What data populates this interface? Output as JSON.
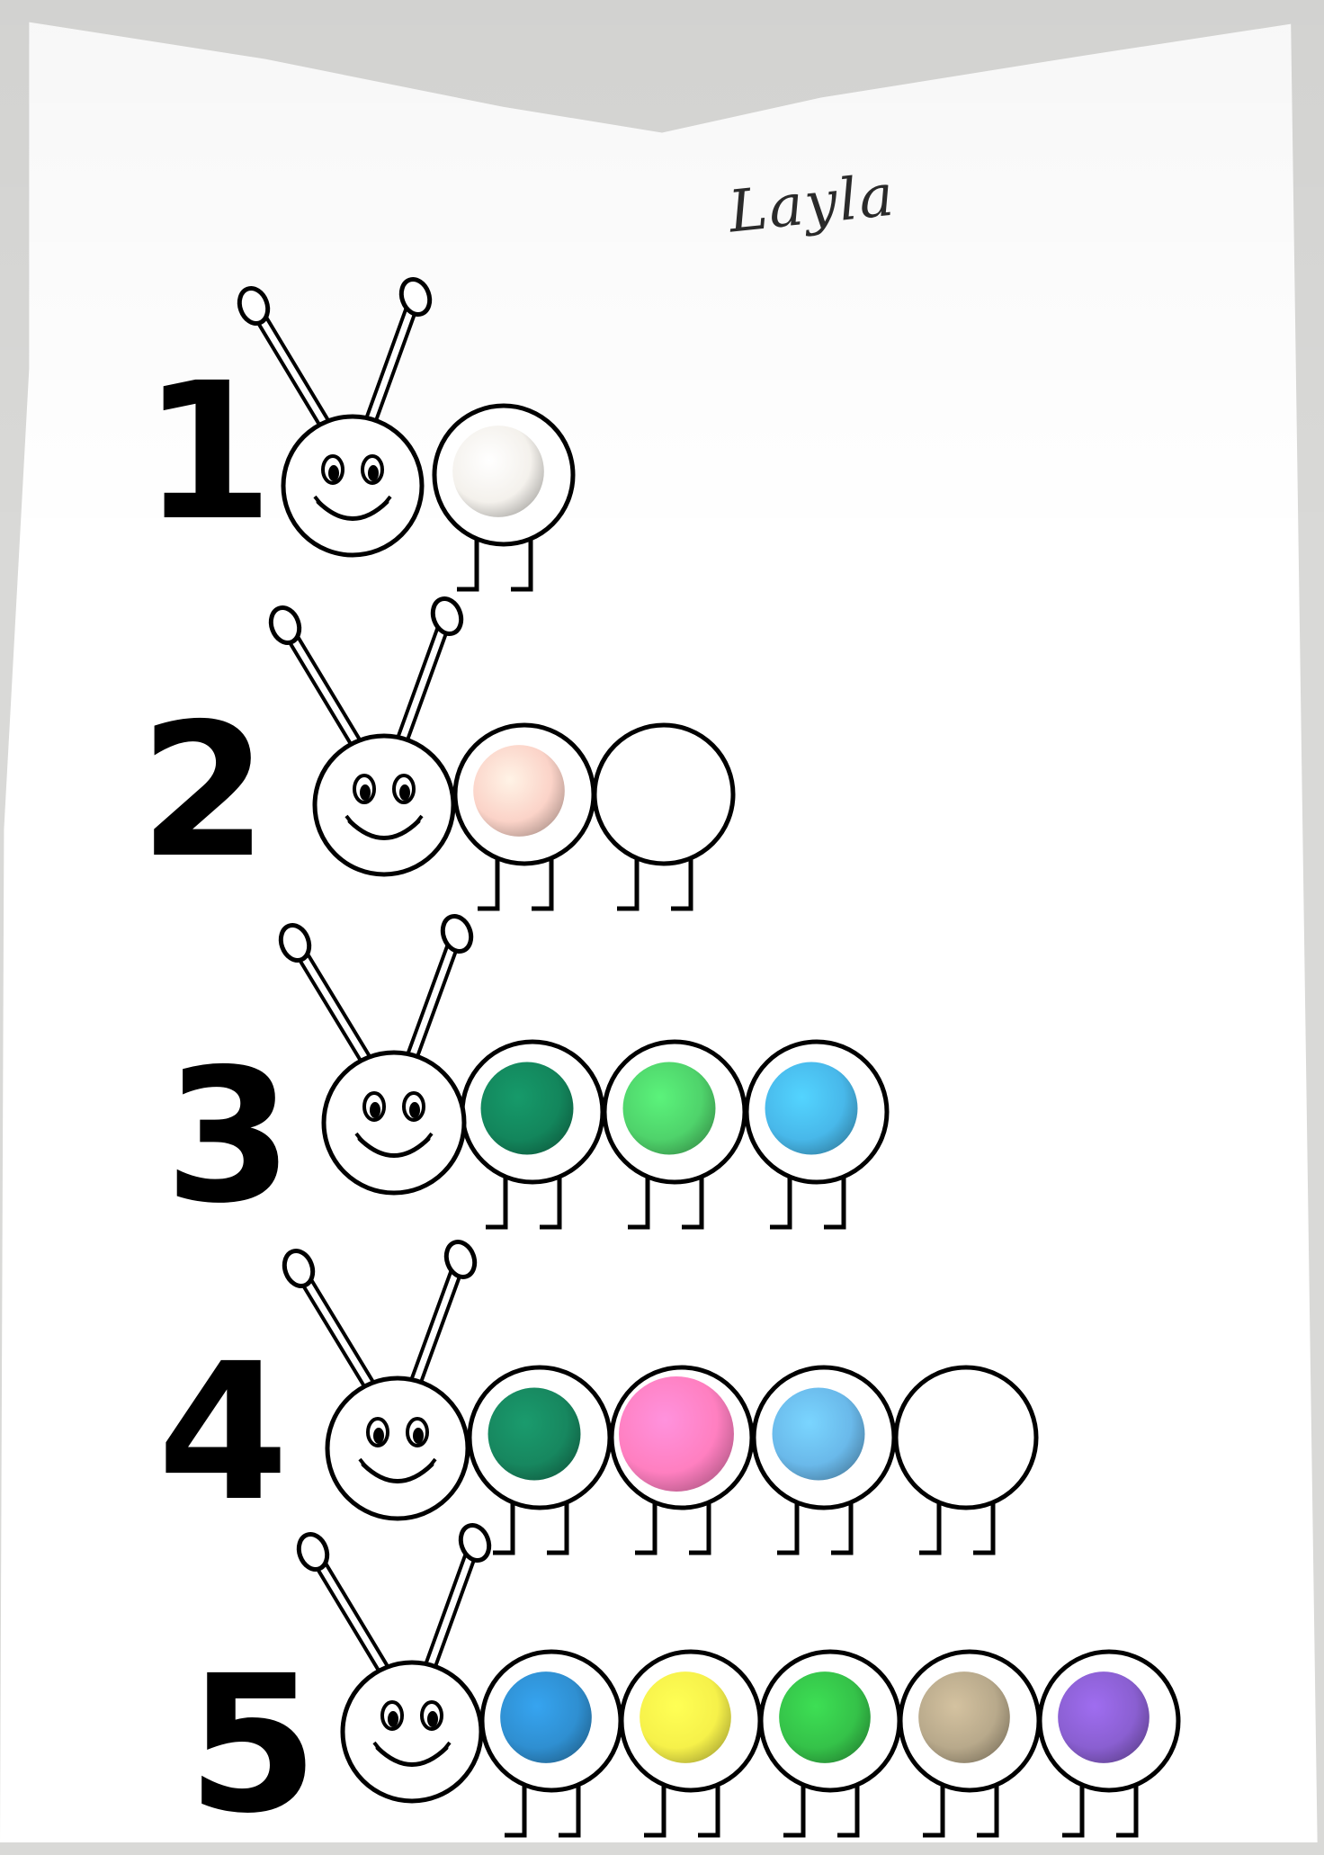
{
  "worksheet": {
    "student_name": "Layla",
    "rows": [
      {
        "number": "1",
        "pompoms": [
          "#f4f1ec"
        ]
      },
      {
        "number": "2",
        "pompoms": [
          "#fbd3c8",
          "#ffffff"
        ]
      },
      {
        "number": "3",
        "pompoms": [
          "#13865c",
          "#4fd36b",
          "#48b8ea"
        ]
      },
      {
        "number": "4",
        "pompoms": [
          "#17875f",
          "#ff7fc0",
          "#6ab9ea",
          "#ffffff"
        ]
      },
      {
        "number": "5",
        "pompoms": [
          "#2f8fd1",
          "#f6f14a",
          "#35c249",
          "#b8a98b",
          "#8a5fd1"
        ]
      }
    ]
  }
}
